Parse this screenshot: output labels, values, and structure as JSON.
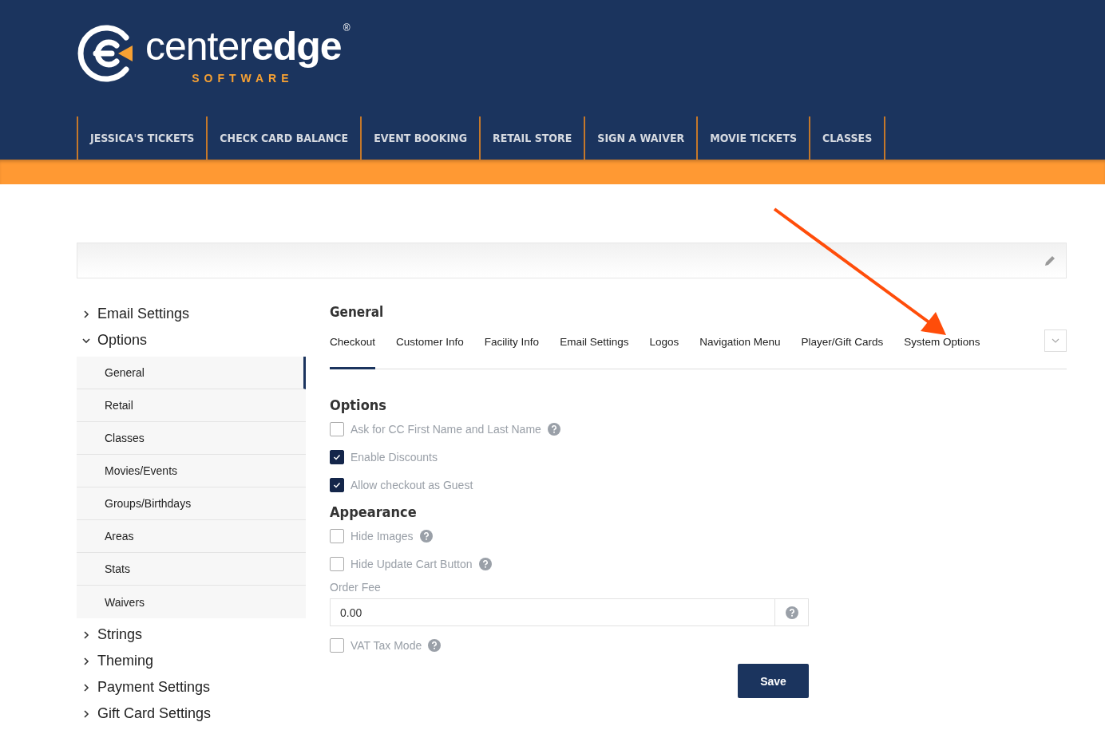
{
  "logo": {
    "wordmark": "center**edge**",
    "registered": "®",
    "tagline": "SOFTWARE"
  },
  "nav": [
    "JESSICA'S TICKETS",
    "CHECK CARD BALANCE",
    "EVENT BOOKING",
    "RETAIL STORE",
    "SIGN A WAIVER",
    "MOVIE TICKETS",
    "CLASSES"
  ],
  "sidebar": [
    {
      "label": "Email Settings",
      "expanded": false
    },
    {
      "label": "Options",
      "expanded": true,
      "children": [
        {
          "label": "General",
          "selected": true
        },
        {
          "label": "Retail",
          "selected": false
        },
        {
          "label": "Classes",
          "selected": false
        },
        {
          "label": "Movies/Events",
          "selected": false
        },
        {
          "label": "Groups/Birthdays",
          "selected": false
        },
        {
          "label": "Areas",
          "selected": false
        },
        {
          "label": "Stats",
          "selected": false
        },
        {
          "label": "Waivers",
          "selected": false
        }
      ]
    },
    {
      "label": "Strings",
      "expanded": false
    },
    {
      "label": "Theming",
      "expanded": false
    },
    {
      "label": "Payment Settings",
      "expanded": false
    },
    {
      "label": "Gift Card Settings",
      "expanded": false
    }
  ],
  "page_title": "General",
  "tabs": [
    {
      "label": "Checkout",
      "selected": true
    },
    {
      "label": "Customer Info",
      "selected": false
    },
    {
      "label": "Facility Info",
      "selected": false
    },
    {
      "label": "Email Settings",
      "selected": false
    },
    {
      "label": "Logos",
      "selected": false
    },
    {
      "label": "Navigation Menu",
      "selected": false
    },
    {
      "label": "Player/Gift Cards",
      "selected": false
    },
    {
      "label": "System Options",
      "selected": false
    }
  ],
  "sections": [
    {
      "heading": "Options",
      "items": [
        {
          "kind": "checkbox",
          "label": "Ask for CC First Name and Last Name",
          "checked": false,
          "help": true
        },
        {
          "kind": "checkbox",
          "label": "Enable Discounts",
          "checked": true,
          "help": false
        },
        {
          "kind": "checkbox",
          "label": "Allow checkout as Guest",
          "checked": true,
          "help": false
        }
      ]
    },
    {
      "heading": "Appearance",
      "items": [
        {
          "kind": "checkbox",
          "label": "Hide Images",
          "checked": false,
          "help": true
        },
        {
          "kind": "checkbox",
          "label": "Hide Update Cart Button",
          "checked": false,
          "help": true
        },
        {
          "kind": "field",
          "label": "Order Fee",
          "value": "0.00",
          "help": true
        },
        {
          "kind": "checkbox",
          "label": "VAT Tax Mode",
          "checked": false,
          "help": true
        }
      ]
    }
  ],
  "save_button": "Save"
}
